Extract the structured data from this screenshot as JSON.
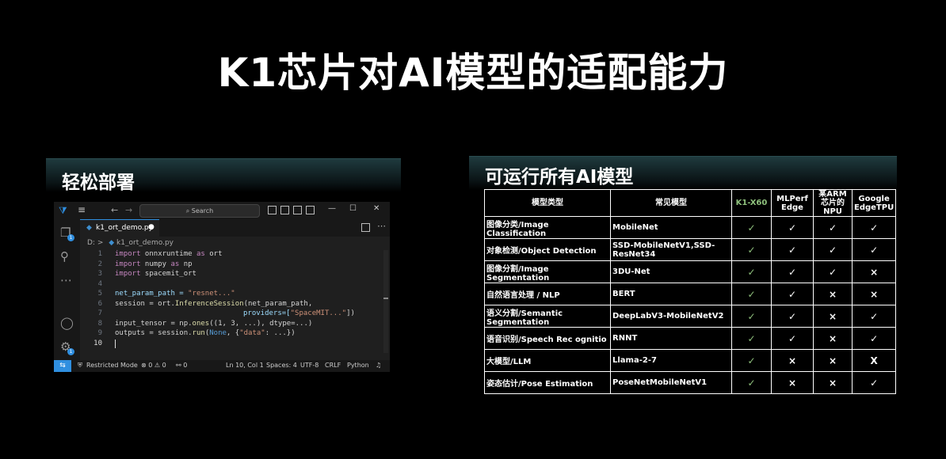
{
  "title": "K1芯片对AI模型的适配能力",
  "left_panel": {
    "heading": "轻松部署"
  },
  "right_panel": {
    "heading": "可运行所有AI模型"
  },
  "vscode": {
    "search_placeholder": "Search",
    "tab_name": "k1_ort_demo.py",
    "tab_modified": "●",
    "breadcrumb_drive": "D: >",
    "breadcrumb_file": "k1_ort_demo.py",
    "explorer_badge": "1",
    "settings_badge": "1",
    "line_numbers": [
      "1",
      "2",
      "3",
      "4",
      "5",
      "6",
      "7",
      "8",
      "9",
      "10"
    ],
    "code": {
      "l1_kw": "import",
      "l1_mod": " onnxruntime ",
      "l1_as": "as",
      "l1_alias": " ort",
      "l2_kw": "import",
      "l2_mod": " numpy ",
      "l2_as": "as",
      "l2_alias": " np",
      "l3_kw": "import",
      "l3_mod": " spacemit_ort",
      "l5_var": "net_param_path = ",
      "l5_str": "\"resnet...\"",
      "l6_a": "session = ort.",
      "l6_fn": "InferenceSession",
      "l6_b": "(net_param_path,",
      "l7_a": "providers=[",
      "l7_str": "\"SpaceMIT...\"",
      "l7_b": "])",
      "l8_a": "input_tensor = np.",
      "l8_fn": "ones",
      "l8_b": "((1, 3, ...), dtype=...)",
      "l9_a": "outputs = session.",
      "l9_fn": "run",
      "l9_b": "(",
      "l9_none": "None",
      "l9_c": ", {",
      "l9_str": "\"data\"",
      "l9_d": ": ...})"
    },
    "status": {
      "restricted": "Restricted Mode",
      "problems": "⊗ 0 ⚠ 0",
      "ports": "⚯ 0",
      "position": "Ln 10, Col 1",
      "spaces": "Spaces: 4",
      "encoding": "UTF-8",
      "eol": "CRLF",
      "language": "Python"
    }
  },
  "table": {
    "headers": [
      "模型类型",
      "常见模型",
      "K1-X60",
      "MLPerf Edge",
      "某ARM芯片的NPU",
      "Google EdgeTPU"
    ],
    "rows": [
      {
        "type": "图像分类/Image Classification",
        "model": "MobileNet",
        "k1": "✓",
        "mlperf": "✓",
        "arm": "✓",
        "tpu": "✓"
      },
      {
        "type": "对象检测/Object Detection",
        "model": "SSD-MobileNetV1,SSD-ResNet34",
        "k1": "✓",
        "mlperf": "✓",
        "arm": "✓",
        "tpu": "✓"
      },
      {
        "type": "图像分割/Image Segmentation",
        "model": "3DU-Net",
        "k1": "✓",
        "mlperf": "✓",
        "arm": "✓",
        "tpu": "×"
      },
      {
        "type": "自然语言处理 / NLP",
        "model": "BERT",
        "k1": "✓",
        "mlperf": "✓",
        "arm": "×",
        "tpu": "×"
      },
      {
        "type": "语义分割/Semantic Segmentation",
        "model": "DeepLabV3-MobileNetV2",
        "k1": "✓",
        "mlperf": "✓",
        "arm": "×",
        "tpu": "✓"
      },
      {
        "type": "语音识别/Speech Rec ognitio",
        "model": "RNNT",
        "k1": "✓",
        "mlperf": "✓",
        "arm": "×",
        "tpu": "✓"
      },
      {
        "type": "大模型/LLM",
        "model": "Llama-2-7",
        "k1": "✓",
        "mlperf": "×",
        "arm": "×",
        "tpu": "X"
      },
      {
        "type": "姿态估计/Pose Estimation",
        "model": "PoseNetMobileNetV1",
        "k1": "✓",
        "mlperf": "×",
        "arm": "×",
        "tpu": "✓"
      }
    ]
  },
  "colors": {
    "accent": "#2f8fe0",
    "k1_check": "#8ec07c"
  }
}
